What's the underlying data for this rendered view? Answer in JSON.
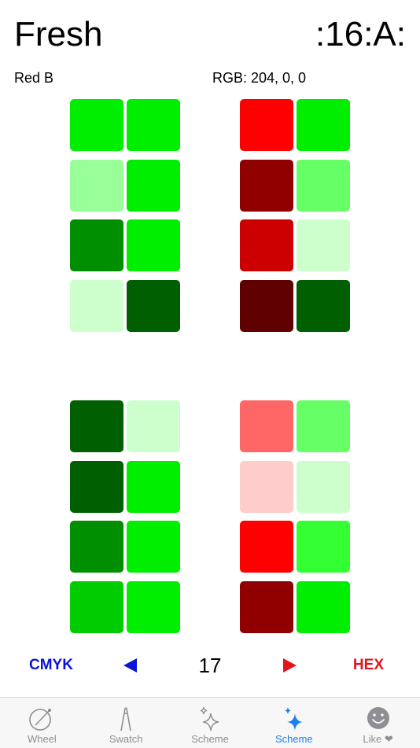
{
  "header": {
    "title": "Fresh",
    "code": ":16:A:"
  },
  "info": {
    "color_name": "Red B",
    "rgb": "RGB: 204, 0, 0"
  },
  "groups": [
    {
      "swatches": [
        "#00ee00",
        "#00ee00",
        "#99ff99",
        "#00ee00",
        "#008f00",
        "#00ee00",
        "#ccffcc",
        "#005f00"
      ]
    },
    {
      "swatches": [
        "#ff0000",
        "#00ee00",
        "#900000",
        "#66ff66",
        "#cc0000",
        "#ccffcc",
        "#600000",
        "#005f00"
      ]
    },
    {
      "swatches": [
        "#005f00",
        "#ccffcc",
        "#005f00",
        "#00ee00",
        "#008f00",
        "#00ee00",
        "#00cc00",
        "#00ee00"
      ]
    },
    {
      "swatches": [
        "#ff6666",
        "#66ff66",
        "#ffcccc",
        "#ccffcc",
        "#ff0000",
        "#33ff33",
        "#900000",
        "#00ee00"
      ]
    }
  ],
  "controls": {
    "left_label": "CMYK",
    "right_label": "HEX",
    "count": "17"
  },
  "colors": {
    "blue_accent": "#0a14d8",
    "red_accent": "#e5141b",
    "tab_active": "#1a7ff0",
    "tab_inactive": "#8e8e93"
  },
  "tabs": [
    {
      "label": "Wheel",
      "icon": "wheel-icon",
      "active": false
    },
    {
      "label": "Swatch",
      "icon": "swatch-icon",
      "active": false
    },
    {
      "label": "Scheme",
      "icon": "sparkle-outline-icon",
      "active": false
    },
    {
      "label": "Scheme",
      "icon": "sparkle-filled-icon",
      "active": true
    },
    {
      "label": "Like ❤",
      "icon": "smiley-icon",
      "active": false
    }
  ]
}
